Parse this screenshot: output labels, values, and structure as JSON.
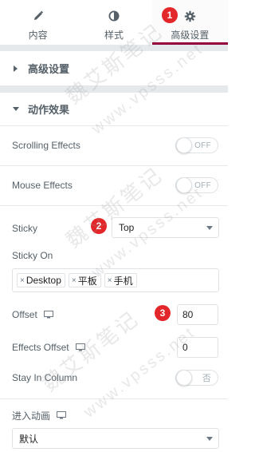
{
  "tabs": [
    {
      "label": "内容",
      "icon": "pencil-icon",
      "active": false
    },
    {
      "label": "样式",
      "icon": "half-circle-icon",
      "active": false
    },
    {
      "label": "高级设置",
      "icon": "gear-icon",
      "active": true
    }
  ],
  "sections": {
    "advanced": {
      "title": "高级设置",
      "expanded": false
    },
    "motion": {
      "title": "动作效果",
      "expanded": true
    }
  },
  "fields": {
    "scrolling_effects": {
      "label": "Scrolling Effects",
      "toggle_text": "OFF"
    },
    "mouse_effects": {
      "label": "Mouse Effects",
      "toggle_text": "OFF"
    },
    "sticky": {
      "label": "Sticky",
      "value": "Top"
    },
    "sticky_on": {
      "label": "Sticky On",
      "tags": [
        "Desktop",
        "平板",
        "手机"
      ]
    },
    "offset": {
      "label": "Offset",
      "value": "80"
    },
    "effects_offset": {
      "label": "Effects Offset",
      "value": "0"
    },
    "stay_in_column": {
      "label": "Stay In Column",
      "toggle_text": "否"
    },
    "entrance_animation": {
      "label": "进入动画",
      "value": "默认"
    }
  },
  "badges": [
    "1",
    "2",
    "3"
  ],
  "watermark": {
    "text_cn": "魏艾斯笔记",
    "text_url": "www.vpsss.net"
  },
  "colors": {
    "accent": "#93003c",
    "badge": "#e3262a",
    "divider": "#e6e9ec"
  }
}
